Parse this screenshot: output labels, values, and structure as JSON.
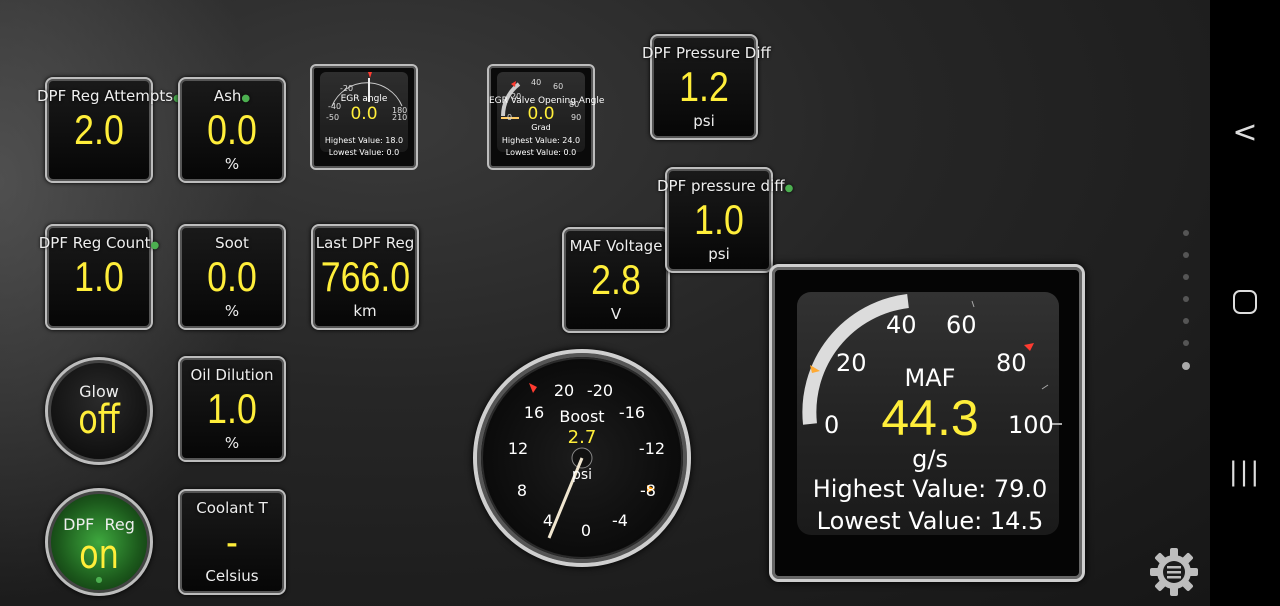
{
  "tiles": {
    "dpf_reg_attempts": {
      "label": "DPF Reg Attempts",
      "value": "2.0",
      "unit": ""
    },
    "ash": {
      "label": "Ash",
      "value": "0.0",
      "unit": "%"
    },
    "dpf_reg_count": {
      "label": "DPF Reg Count",
      "value": "1.0",
      "unit": ""
    },
    "soot": {
      "label": "Soot",
      "value": "0.0",
      "unit": "%"
    },
    "last_dpf_reg": {
      "label": "Last DPF Reg",
      "value": "766.0",
      "unit": "km"
    },
    "oil_dilution": {
      "label": "Oil Dilution",
      "value": "1.0",
      "unit": "%"
    },
    "coolant_t": {
      "label": "Coolant T",
      "value": "-",
      "unit": "Celsius"
    },
    "dpf_pressure_diff": {
      "label": "DPF Pressure Diff",
      "value": "1.2",
      "unit": "psi"
    },
    "dpf_pressure_diff_2": {
      "label": "DPF pressure diff",
      "value": "1.0",
      "unit": "psi"
    },
    "maf_voltage": {
      "label": "MAF Voltage",
      "value": "2.8",
      "unit": "V"
    }
  },
  "round_indicators": {
    "glow": {
      "label": "Glow",
      "value": "off"
    },
    "dpf_reg": {
      "label": "DPF  Reg",
      "value": "on"
    }
  },
  "mini_gauges": {
    "egr_angle": {
      "title": "EGR angle",
      "value": "0.0",
      "unit": "",
      "ticks": [
        "-20",
        "-40",
        "-50",
        "180",
        "210"
      ],
      "highest": "Highest Value: 18.0",
      "lowest": "Lowest Value: 0.0"
    },
    "egr_valve": {
      "title": "EGR Valve Opening Angle",
      "value": "0.0",
      "unit": "Grad",
      "ticks": [
        "40",
        "60",
        "20",
        "80",
        "0",
        "90"
      ],
      "highest": "Highest Value: 24.0",
      "lowest": "Lowest Value: 0.0"
    }
  },
  "boost_gauge": {
    "title": "Boost",
    "value": "2.7",
    "unit": "psi",
    "ticks": [
      "20",
      "-20",
      "16",
      "-16",
      "12",
      "-12",
      "8",
      "-8",
      "4",
      "-4",
      "0"
    ]
  },
  "maf_gauge": {
    "title": "MAF",
    "value": "44.3",
    "unit": "g/s",
    "ticks": [
      "40",
      "60",
      "20",
      "80",
      "0",
      "100"
    ],
    "highest": "Highest Value: 79.0",
    "lowest": "Lowest Value: 14.5",
    "min": 0,
    "max": 100
  },
  "nav": {
    "back": "<",
    "recents": "|||"
  },
  "colors": {
    "value": "#ffee3a",
    "green_on": "#1f6e1f",
    "warning": "#ff3b30"
  }
}
